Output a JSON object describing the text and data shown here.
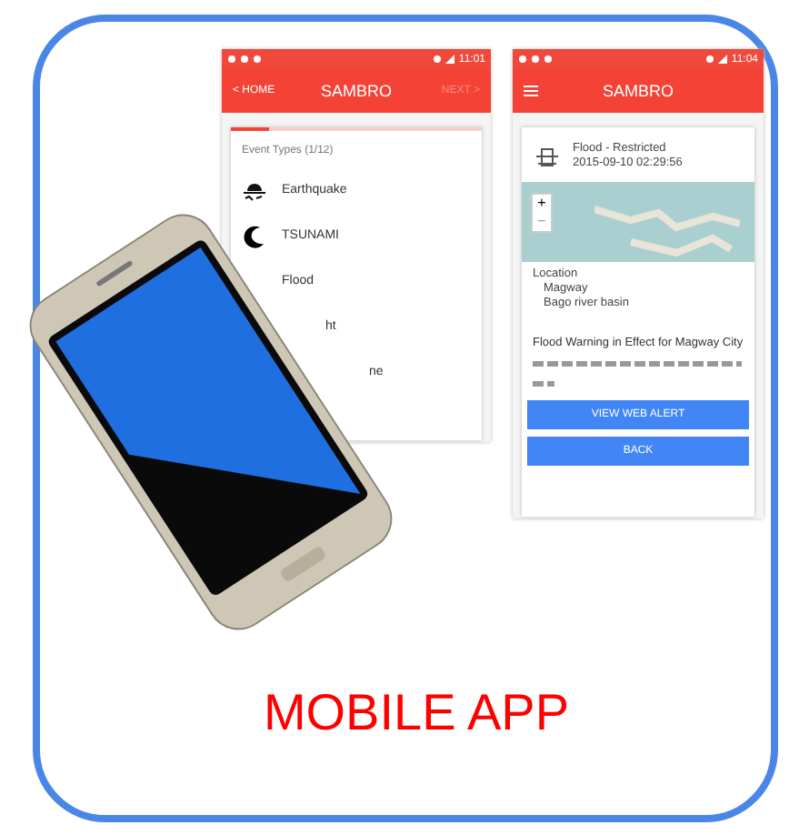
{
  "event_screen": {
    "status_time": "11:01",
    "header": {
      "back": "< HOME",
      "title": "SAMBRO",
      "next": {
        "label": "NEXT >",
        "disabled": true
      }
    },
    "progress": {
      "level": 0.15
    },
    "section_label": "Event Types (1/12)",
    "event_types": [
      {
        "label": "Earthquake",
        "kind": "earthquake"
      },
      {
        "label": "TSUNAMI",
        "kind": "tsunami"
      },
      {
        "label": "Flood",
        "kind": "none"
      },
      {
        "label": "ht",
        "kind": "hidden"
      },
      {
        "label": "ne",
        "kind": "hidden"
      }
    ]
  },
  "alert_screen": {
    "status_time": "11:04",
    "header": {
      "title": "SAMBRO"
    },
    "alert": {
      "title": "Flood - Restricted",
      "time": "2015-09-10 02:29:56"
    },
    "map": {
      "zoom_in": "+",
      "zoom_out": "−"
    },
    "location_label": "Location",
    "locations": [
      "Magway",
      "Bago river basin"
    ],
    "headline": "Flood Warning in Effect for Magway City",
    "buttons": [
      "VIEW WEB ALERT",
      "BACK"
    ]
  },
  "caption": "MOBILE APP"
}
